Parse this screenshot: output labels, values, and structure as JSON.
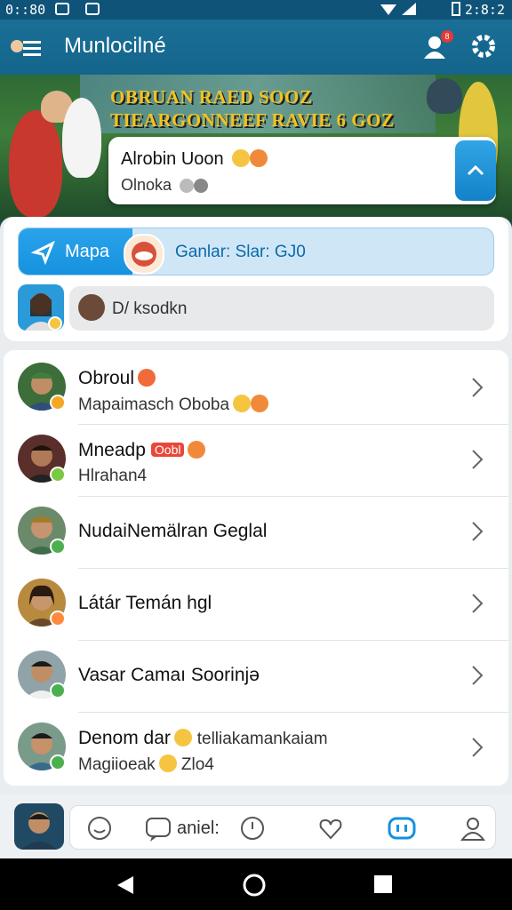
{
  "status_bar": {
    "time": "0::80",
    "right_text": "2:8:2"
  },
  "app_bar": {
    "title": "Munlocilné",
    "notification_count": "8"
  },
  "banner": {
    "headline_line1": "OBRUAN RAED SOOZ",
    "headline_line2": "TIEARGONNEEF RAVIE 6 GOZ",
    "card_name": "Alrobin Uoon",
    "card_sub": "Olnoka"
  },
  "quick": {
    "chip_label": "Mapa",
    "chip_text": "Ganlar: Slar: GJ0",
    "search_text": "D/ ksodkn"
  },
  "contacts": [
    {
      "name": "Obroul",
      "sub": "Mapaimasch Oboba",
      "status_color": "#f5a623"
    },
    {
      "name": "Mneadp",
      "tag": "Oobl",
      "sub": "Hlrahan4",
      "status_color": "#7ac943"
    },
    {
      "name": "NudaiNemälran Geglal",
      "sub": "",
      "status_color": "#4caf50"
    },
    {
      "name": "Látár Temán hgl",
      "sub": "",
      "status_color": "#ff8a3d"
    },
    {
      "name": "Vasar Camaı Soorinjə",
      "sub": "",
      "status_color": "#4caf50"
    },
    {
      "name": "Denom dar",
      "name_extra": "telliakamankaiam",
      "sub": "Magiioeak",
      "sub_extra": "Zlo4",
      "status_color": "#4caf50"
    }
  ],
  "bottom_bar": {
    "tab_text": "aniel:"
  },
  "colors": {
    "app_bar": "#14658c",
    "accent": "#1591de",
    "badge": "#e53935"
  }
}
